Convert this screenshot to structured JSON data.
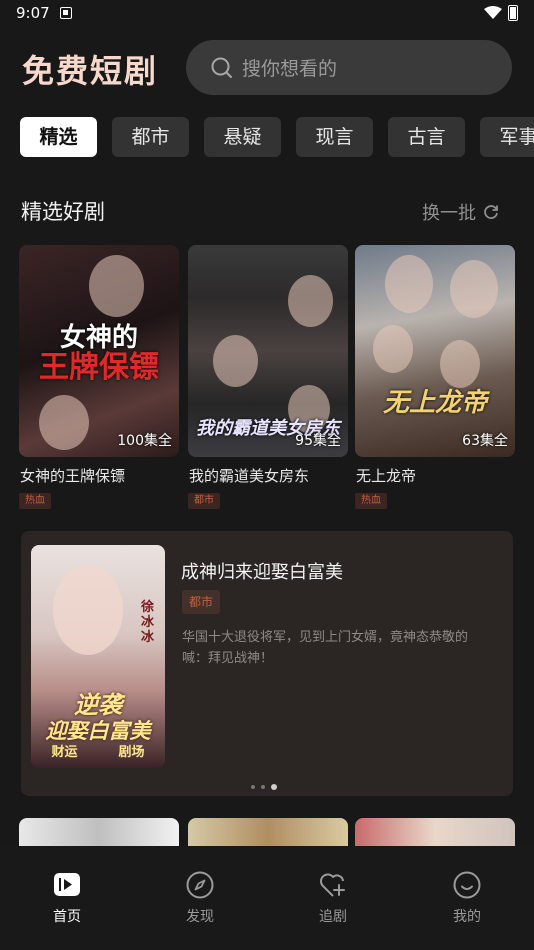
{
  "status_bar": {
    "time": "9:07"
  },
  "header": {
    "title": "免费短剧",
    "search_placeholder": "搜你想看的"
  },
  "tabs": [
    {
      "label": "精选",
      "active": true
    },
    {
      "label": "都市",
      "active": false
    },
    {
      "label": "悬疑",
      "active": false
    },
    {
      "label": "现言",
      "active": false
    },
    {
      "label": "古言",
      "active": false
    },
    {
      "label": "军事",
      "active": false
    }
  ],
  "section": {
    "title": "精选好剧",
    "refresh_label": "换一批"
  },
  "cards": [
    {
      "title": "女神的王牌保镖",
      "episodes": "100集全",
      "tag": "热血",
      "poster_art": [
        "女神的",
        "王牌保镖"
      ]
    },
    {
      "title": "我的霸道美女房东",
      "episodes": "95集全",
      "tag": "都市",
      "poster_art": [
        "我的霸道美女房东"
      ]
    },
    {
      "title": "无上龙帝",
      "episodes": "63集全",
      "tag": "热血",
      "poster_art": [
        "无上龙帝"
      ]
    }
  ],
  "feature": {
    "title": "成神归来迎娶白富美",
    "tag": "都市",
    "description": "华国十大退役将军，见到上门女婿，竟神态恭敬的喊：拜见战神！",
    "poster_art": {
      "side": "徐冰冰",
      "line1": "逆袭",
      "line2": "迎娶白富美",
      "foot_left": "财运",
      "foot_right": "剧场"
    }
  },
  "nav": [
    {
      "label": "首页",
      "icon": "play-square-icon",
      "active": true
    },
    {
      "label": "发现",
      "icon": "compass-icon",
      "active": false
    },
    {
      "label": "追剧",
      "icon": "heart-plus-icon",
      "active": false
    },
    {
      "label": "我的",
      "icon": "smile-icon",
      "active": false
    }
  ],
  "colors": {
    "accent": "#f6d8cc",
    "tag": "#c2623f",
    "background": "#181818"
  }
}
